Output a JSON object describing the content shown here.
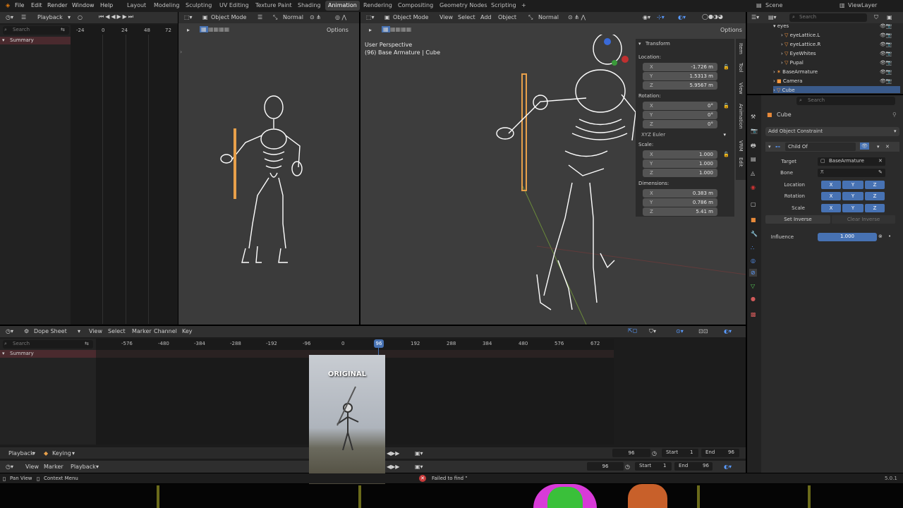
{
  "menu": {
    "file": "File",
    "edit": "Edit",
    "render": "Render",
    "window": "Window",
    "help": "Help"
  },
  "workspaces": [
    "Layout",
    "Modeling",
    "Sculpting",
    "UV Editing",
    "Texture Paint",
    "Shading",
    "Animation",
    "Rendering",
    "Compositing",
    "Geometry Nodes",
    "Scripting"
  ],
  "active_workspace": "Animation",
  "scene": "Scene",
  "view_layer": "ViewLayer",
  "top_left": {
    "playback": "Playback",
    "search_placeholder": "Search",
    "summary": "Summary",
    "ruler": [
      "-24",
      "0",
      "24",
      "48",
      "72"
    ]
  },
  "viewport_left": {
    "mode": "Object Mode",
    "shading": "Normal",
    "options": "Options"
  },
  "viewport_main": {
    "mode": "Object Mode",
    "menus": [
      "View",
      "Select",
      "Add",
      "Object"
    ],
    "shading": "Normal",
    "options": "Options",
    "perspective": "User Perspective",
    "object_label": "(96) Base Armature | Cube"
  },
  "side_tabs": [
    "Item",
    "Tool",
    "View",
    "Animation",
    "VRM",
    "Edit"
  ],
  "transform": {
    "title": "Transform",
    "location_label": "Location:",
    "location": [
      {
        "axis": "X",
        "value": "-1.726 m"
      },
      {
        "axis": "Y",
        "value": "1.5313 m"
      },
      {
        "axis": "Z",
        "value": "5.9567 m"
      }
    ],
    "rotation_label": "Rotation:",
    "rotation": [
      {
        "axis": "X",
        "value": "0°"
      },
      {
        "axis": "Y",
        "value": "0°"
      },
      {
        "axis": "Z",
        "value": "0°"
      }
    ],
    "rotation_mode": "XYZ Euler",
    "scale_label": "Scale:",
    "scale": [
      {
        "axis": "X",
        "value": "1.000"
      },
      {
        "axis": "Y",
        "value": "1.000"
      },
      {
        "axis": "Z",
        "value": "1.000"
      }
    ],
    "dimensions_label": "Dimensions:",
    "dimensions": [
      {
        "axis": "X",
        "value": "0.383 m"
      },
      {
        "axis": "Y",
        "value": "0.786 m"
      },
      {
        "axis": "Z",
        "value": "5.41 m"
      }
    ]
  },
  "outliner": {
    "search_placeholder": "Search",
    "items": [
      "eyes",
      "eyeLattice.L",
      "eyeLattice.R",
      "EyeWhites",
      "Pupal",
      "BaseArmature",
      "Camera",
      "Cube"
    ]
  },
  "properties": {
    "search_placeholder": "Search",
    "object": "Cube",
    "add_constraint": "Add Object Constraint",
    "constraint_name": "Child Of",
    "target_label": "Target",
    "target_value": "BaseArmature",
    "bone_label": "Bone",
    "location_label": "Location",
    "rotation_label": "Rotation",
    "scale_label": "Scale",
    "axes": [
      "X",
      "Y",
      "Z"
    ],
    "set_inverse": "Set Inverse",
    "clear_inverse": "Clear Inverse",
    "influence_label": "Influence",
    "influence_value": "1.000",
    "influence_fraction": 1.0
  },
  "dopesheet": {
    "editor": "Dope Sheet",
    "menus": [
      "View",
      "Select",
      "Marker",
      "Channel",
      "Key"
    ],
    "search_placeholder": "Search",
    "summary": "Summary",
    "ruler": [
      "-576",
      "-480",
      "-384",
      "-288",
      "-192",
      "-96",
      "0",
      "96",
      "192",
      "288",
      "384",
      "480",
      "576",
      "672"
    ],
    "current_frame": "96",
    "playback": "Playback",
    "keying": "Keying",
    "frame_display": "96",
    "start_label": "Start",
    "start_value": "1",
    "end_label": "End",
    "end_value": "96"
  },
  "timeline": {
    "menus": [
      "View",
      "Marker",
      "Playback"
    ],
    "frame": "96",
    "start_label": "Start",
    "start_value": "1",
    "end_label": "End",
    "end_value": "96"
  },
  "overlay_label": "ORIGINAL",
  "status": {
    "pan_view": "Pan View",
    "context_menu": "Context Menu",
    "error": "Failed to find \"",
    "version": "5.0.1"
  }
}
